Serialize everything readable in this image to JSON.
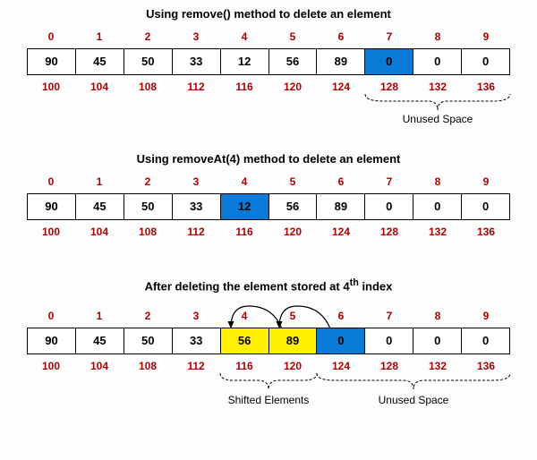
{
  "block1": {
    "title": "Using remove() method to delete an element",
    "indices": [
      "0",
      "1",
      "2",
      "3",
      "4",
      "5",
      "6",
      "7",
      "8",
      "9"
    ],
    "values": [
      "90",
      "45",
      "50",
      "33",
      "12",
      "56",
      "89",
      "0",
      "0",
      "0"
    ],
    "addrs": [
      "100",
      "104",
      "108",
      "112",
      "116",
      "120",
      "124",
      "128",
      "132",
      "136"
    ],
    "highlight_blue": [
      7
    ],
    "brace_label": "Unused Space"
  },
  "block2": {
    "title": "Using removeAt(4) method to delete an element",
    "indices": [
      "0",
      "1",
      "2",
      "3",
      "4",
      "5",
      "6",
      "7",
      "8",
      "9"
    ],
    "values": [
      "90",
      "45",
      "50",
      "33",
      "12",
      "56",
      "89",
      "0",
      "0",
      "0"
    ],
    "addrs": [
      "100",
      "104",
      "108",
      "112",
      "116",
      "120",
      "124",
      "128",
      "132",
      "136"
    ],
    "highlight_blue": [
      4
    ]
  },
  "block3": {
    "title_prefix": "After deleting the element stored at 4",
    "title_sup": "th",
    "title_suffix": " index",
    "indices": [
      "0",
      "1",
      "2",
      "3",
      "4",
      "5",
      "6",
      "7",
      "8",
      "9"
    ],
    "values": [
      "90",
      "45",
      "50",
      "33",
      "56",
      "89",
      "0",
      "0",
      "0",
      "0"
    ],
    "addrs": [
      "100",
      "104",
      "108",
      "112",
      "116",
      "120",
      "124",
      "128",
      "132",
      "136"
    ],
    "highlight_yellow": [
      4,
      5
    ],
    "highlight_blue": [
      6
    ],
    "brace1_label": "Shifted Elements",
    "brace2_label": "Unused Space"
  }
}
